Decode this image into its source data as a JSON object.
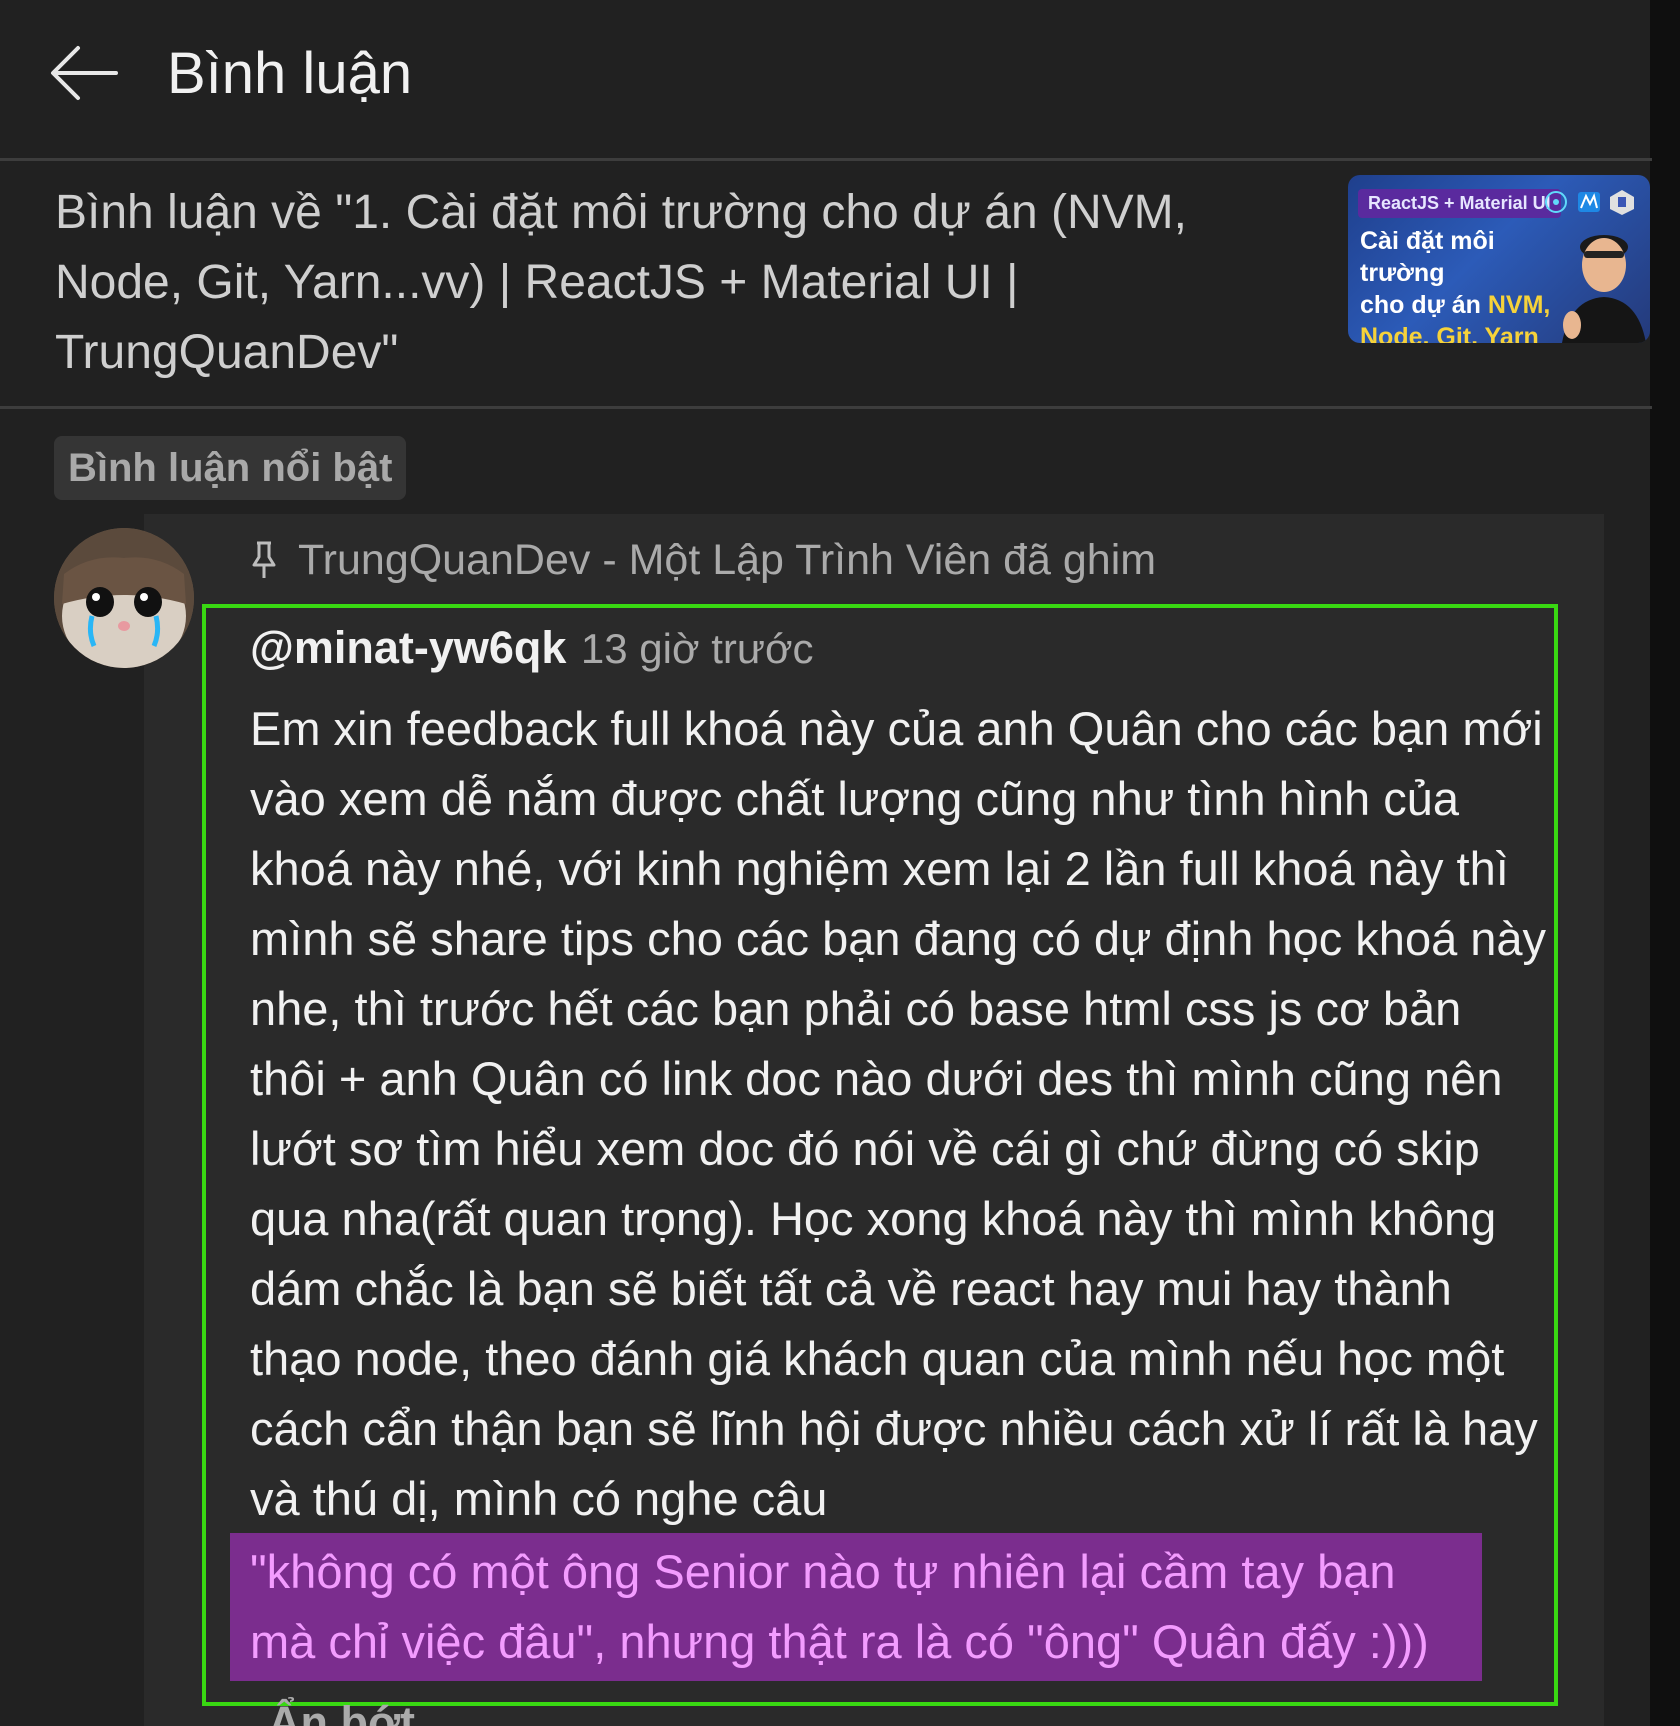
{
  "header": {
    "title": "Bình luận"
  },
  "context": {
    "title": "Bình luận về \"1. Cài đặt môi trường cho dự án (NVM, Node, Git, Yarn...vv) | ReactJS + Material UI | TrungQuanDev\"",
    "thumbnail": {
      "tag": "ReactJS + Material UI",
      "line1": "Cài đặt môi trường",
      "line2_plain": "cho dự án ",
      "line2_hl": "NVM,",
      "line3_hl": "Node, Git, Yarn"
    }
  },
  "filter": {
    "chip_label": "Bình luận nổi bật"
  },
  "comment": {
    "pinned_text": "TrungQuanDev - Một Lập Trình Viên đã ghim",
    "author": "@minat-yw6qk",
    "time": "13 giờ trước",
    "body": "Em xin feedback full khoá này của anh Quân cho các bạn mới vào xem dễ nắm được chất lượng cũng như tình hình của khoá này nhé, với kinh nghiệm xem lại 2 lần full khoá này thì mình sẽ share tips cho các bạn đang có dự định học khoá này nhe, thì trước hết các bạn phải có base html css js cơ bản thôi + anh Quân có link doc nào dưới des thì mình cũng nên lướt sơ tìm hiểu xem doc đó nói về cái gì chứ đừng có skip qua nha(rất quan trọng). Học xong khoá này thì mình không dám chắc là bạn sẽ biết tất cả về react hay mui hay thành thạo node, theo đánh giá khách quan của mình nếu học một cách cẩn thận bạn sẽ lĩnh hội được nhiều cách xử lí rất là hay và thú dị, mình có nghe câu",
    "highlighted": "\"không có một ông Senior nào tự nhiên lại cầm tay bạn mà chỉ việc đâu\", nhưng thật ra là có \"ông\" Quân đấy :)))",
    "collapse_label": "Ẩn bớt"
  },
  "colors": {
    "background": "#212121",
    "highlight_border": "#39d812",
    "highlight_fill": "#7b2d8e",
    "highlight_text": "#f39cff"
  },
  "icons": [
    "back-arrow-icon",
    "pin-icon"
  ]
}
